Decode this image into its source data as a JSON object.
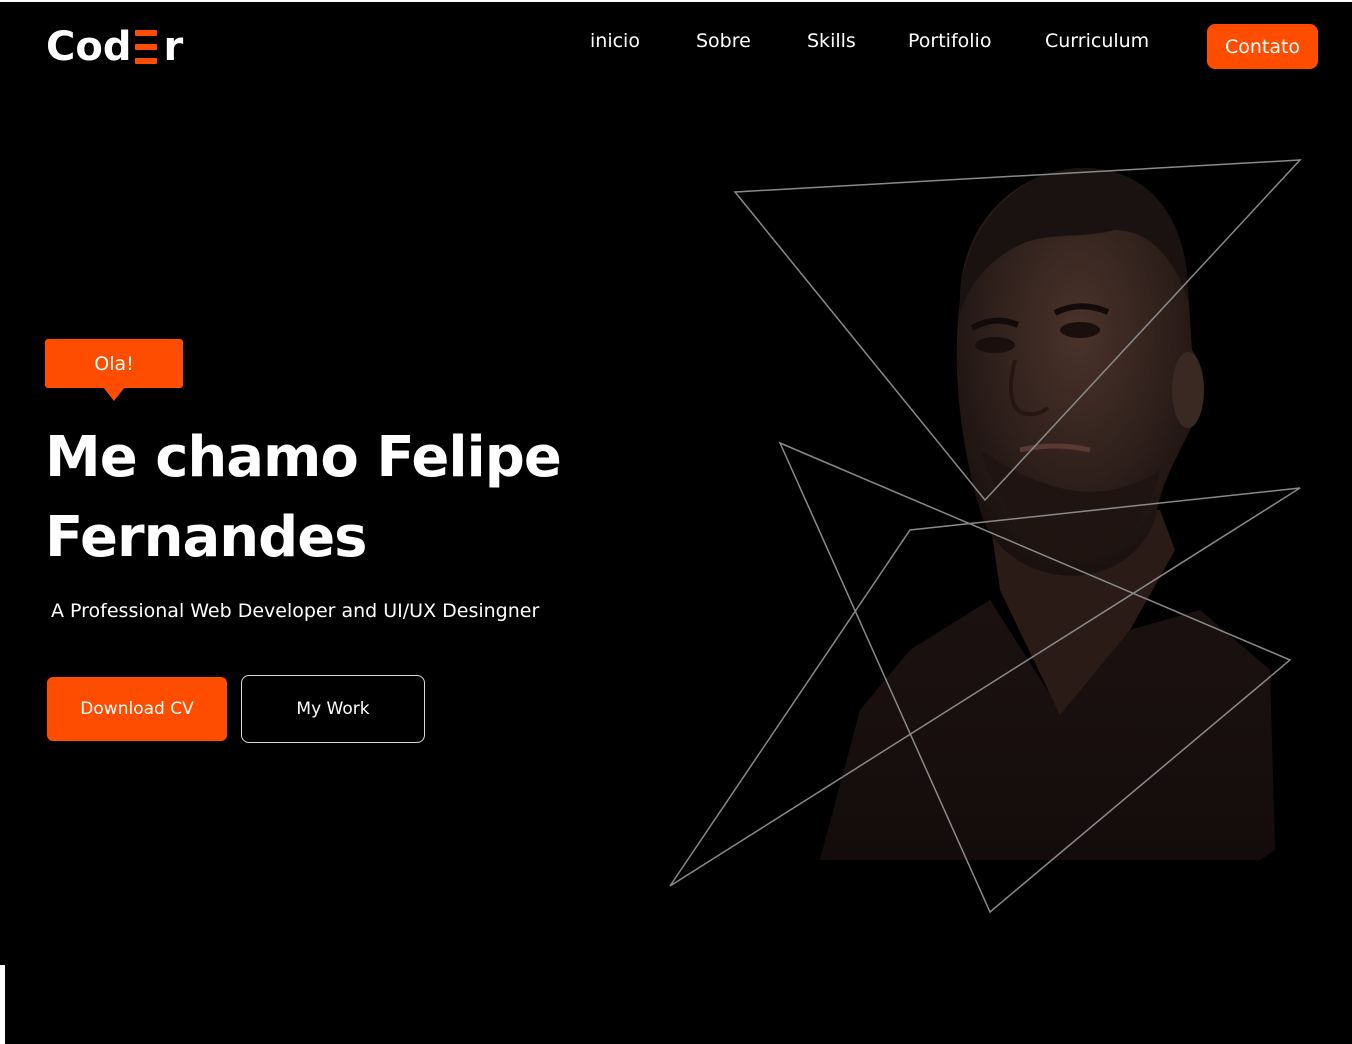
{
  "header": {
    "logo_text_left": "Cod",
    "logo_text_right": "r",
    "nav": [
      "inicio",
      "Sobre",
      "Skills",
      "Portifolio",
      "Curriculum"
    ],
    "contact_label": "Contato"
  },
  "hero": {
    "greeting": "Ola!",
    "title_line1": "Me chamo Felipe",
    "title_line2": "Fernandes",
    "subtitle": "A Professional Web Developer and UI/UX Desingner",
    "download_label": "Download CV",
    "work_label": "My Work"
  },
  "colors": {
    "accent": "#ff4d00",
    "background": "#000000",
    "text": "#ffffff"
  },
  "icons": {
    "logo_mark": "three-bar-e-icon"
  }
}
